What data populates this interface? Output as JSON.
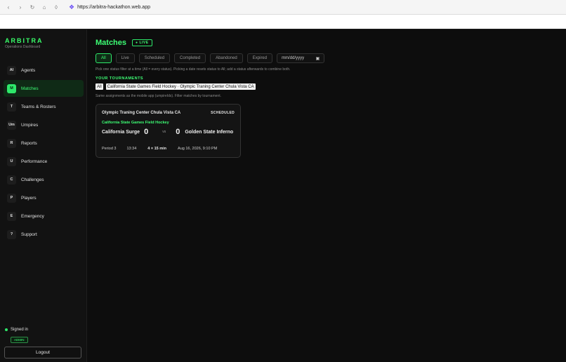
{
  "browser": {
    "url": "https://arbitra-hackathon.web.app"
  },
  "brand": {
    "name": "ARBITRA",
    "subtitle": "Operations Dashboard"
  },
  "sidebar": {
    "items": [
      {
        "badge": "AI",
        "label": "Agents"
      },
      {
        "badge": "M",
        "label": "Matches"
      },
      {
        "badge": "T",
        "label": "Teams & Rosters"
      },
      {
        "badge": "Um",
        "label": "Umpires"
      },
      {
        "badge": "R",
        "label": "Reports"
      },
      {
        "badge": "U",
        "label": "Performance"
      },
      {
        "badge": "C",
        "label": "Challenges"
      },
      {
        "badge": "P",
        "label": "Players"
      },
      {
        "badge": "E",
        "label": "Emergency"
      },
      {
        "badge": "?",
        "label": "Support"
      }
    ],
    "active_index": 1,
    "signed_in": "Signed in",
    "role": "ADMIN",
    "logout": "Logout"
  },
  "main": {
    "title": "Matches",
    "live_badge": "● LIVE",
    "filters": [
      "All",
      "Live",
      "Scheduled",
      "Completed",
      "Abandoned",
      "Expired"
    ],
    "active_filter": "All",
    "date_placeholder": "mm/dd/yyyy",
    "hint": "Pick one status filter at a time (All = every status). Picking a date resets status to All; add a status afterwards to combine both.",
    "tournaments_heading": "YOUR TOURNAMENTS",
    "tournaments": [
      "All",
      "California State Games Field Hockey · Olympic Traning Center Chula Vista CA"
    ],
    "tournaments_hint": "Same assignments as the mobile app (umpireIds). Filter matches by tournament."
  },
  "match": {
    "venue": "Olympic Traning Center Chula Vista CA",
    "status": "SCHEDULED",
    "league": "California State Games Field Hockey",
    "home_team": "California Surge",
    "home_score": "0",
    "vs": "vs",
    "away_score": "0",
    "away_team": "Golden State Inferno",
    "period": "Period 3",
    "clock": "13:34",
    "format": "4 × 15 min",
    "datetime": "Aug 16, 2026, 9:10 PM"
  },
  "colors": {
    "accent": "#3dff75",
    "background": "#0d0d0d"
  }
}
